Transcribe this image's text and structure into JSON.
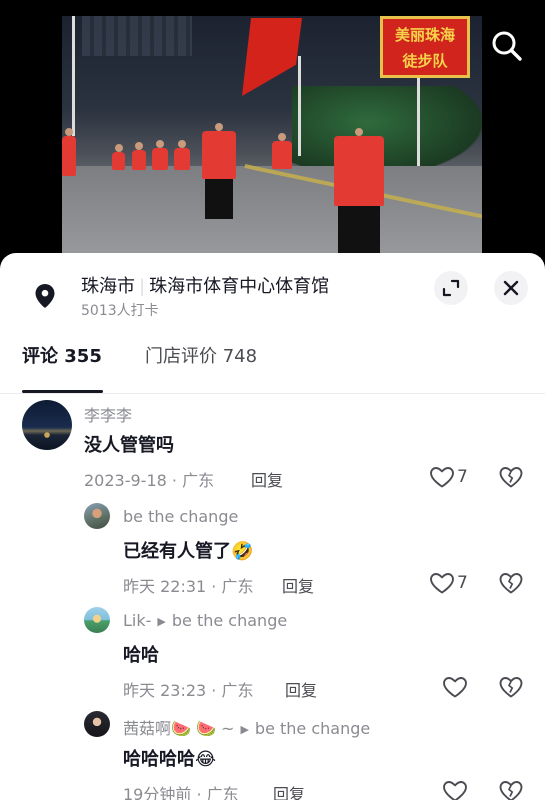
{
  "video": {
    "sign_text_line1": "美丽珠海",
    "sign_text_line2": "徒步队",
    "search_icon": "search-icon"
  },
  "location": {
    "city": "珠海市",
    "venue": "珠海市体育中心体育馆",
    "checkins": "5013人打卡"
  },
  "tabs": {
    "comments_label": "评论 355",
    "reviews_label": "门店评价 748"
  },
  "comments": [
    {
      "author": "李李李",
      "text": "没人管管吗",
      "date": "2023-9-18",
      "region": "广东",
      "reply_label": "回复",
      "likes": "7"
    },
    {
      "author": "be the change",
      "text": "已经有人管了",
      "emoji": "🤣",
      "date": "昨天 22:31",
      "region": "广东",
      "reply_label": "回复",
      "likes": "7"
    },
    {
      "author": "Lik-",
      "reply_to": "be the change",
      "text": "哈哈",
      "date": "昨天 23:23",
      "region": "广东",
      "reply_label": "回复"
    },
    {
      "author": "茜菇啊",
      "author_emoji": "🍉 🍉 ~",
      "reply_to": "be the change",
      "text": "哈哈哈哈",
      "emoji": "😂",
      "date": "19分钟前",
      "region": "广东",
      "reply_label": "回复"
    }
  ],
  "meta_separator": " · ",
  "colors": {
    "primary_text": "#161823",
    "secondary_text": "#8a8b91",
    "panel_bg": "#ffffff"
  }
}
